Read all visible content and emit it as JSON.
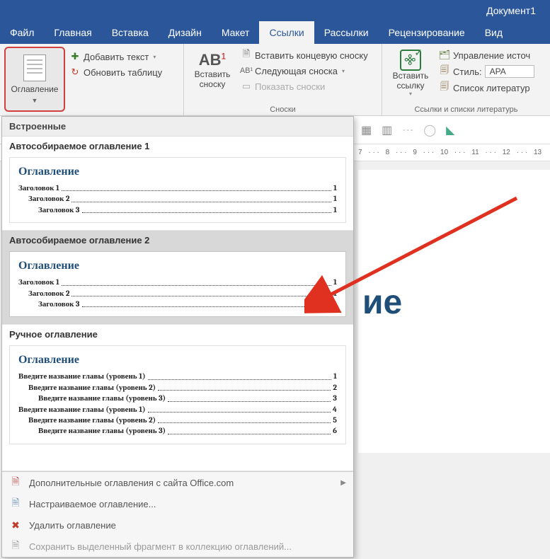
{
  "title": "Документ1",
  "tabs": [
    "Файл",
    "Главная",
    "Вставка",
    "Дизайн",
    "Макет",
    "Ссылки",
    "Рассылки",
    "Рецензирование",
    "Вид"
  ],
  "active_tab": "Ссылки",
  "ribbon": {
    "toc_button": "Оглавление",
    "add_text": "Добавить текст",
    "update_table": "Обновить таблицу",
    "insert_footnote_big": "Вставить сноску",
    "insert_endnote": "Вставить концевую сноску",
    "next_footnote": "Следующая сноска",
    "show_notes": "Показать сноски",
    "footnotes_caption": "Сноски",
    "insert_link_big": "Вставить ссылку",
    "manage_sources": "Управление источ",
    "style_label": "Стиль:",
    "style_value": "APA",
    "bibliography": "Список литератур",
    "citations_caption": "Ссылки и списки литературь"
  },
  "gallery": {
    "builtin_header": "Встроенные",
    "items": [
      {
        "title": "Автособираемое оглавление 1",
        "preview_title": "Оглавление",
        "lines": [
          {
            "text": "Заголовок 1",
            "page": "1",
            "lvl": 1
          },
          {
            "text": "Заголовок 2",
            "page": "1",
            "lvl": 2
          },
          {
            "text": "Заголовок 3",
            "page": "1",
            "lvl": 3
          }
        ]
      },
      {
        "title": "Автособираемое оглавление 2",
        "preview_title": "Оглавление",
        "lines": [
          {
            "text": "Заголовок 1",
            "page": "1",
            "lvl": 1
          },
          {
            "text": "Заголовок 2",
            "page": "1",
            "lvl": 2
          },
          {
            "text": "Заголовок 3",
            "page": "1",
            "lvl": 3
          }
        ]
      },
      {
        "title": "Ручное оглавление",
        "preview_title": "Оглавление",
        "lines": [
          {
            "text": "Введите название главы (уровень 1)",
            "page": "1",
            "lvl": 1
          },
          {
            "text": "Введите название главы (уровень 2)",
            "page": "2",
            "lvl": 2
          },
          {
            "text": "Введите название главы (уровень 3)",
            "page": "3",
            "lvl": 3
          },
          {
            "text": "Введите название главы (уровень 1)",
            "page": "4",
            "lvl": 1
          },
          {
            "text": "Введите название главы (уровень 2)",
            "page": "5",
            "lvl": 2
          },
          {
            "text": "Введите название главы (уровень 3)",
            "page": "6",
            "lvl": 3
          }
        ]
      }
    ],
    "footer": {
      "more_office": "Дополнительные оглавления с сайта Office.com",
      "custom": "Настраиваемое оглавление...",
      "remove": "Удалить оглавление",
      "save_selection": "Сохранить выделенный фрагмент в коллекцию оглавлений..."
    }
  },
  "ruler_ticks": [
    "7",
    "8",
    "9",
    "10",
    "11",
    "12",
    "13"
  ],
  "doc_text_fragment": "ие"
}
